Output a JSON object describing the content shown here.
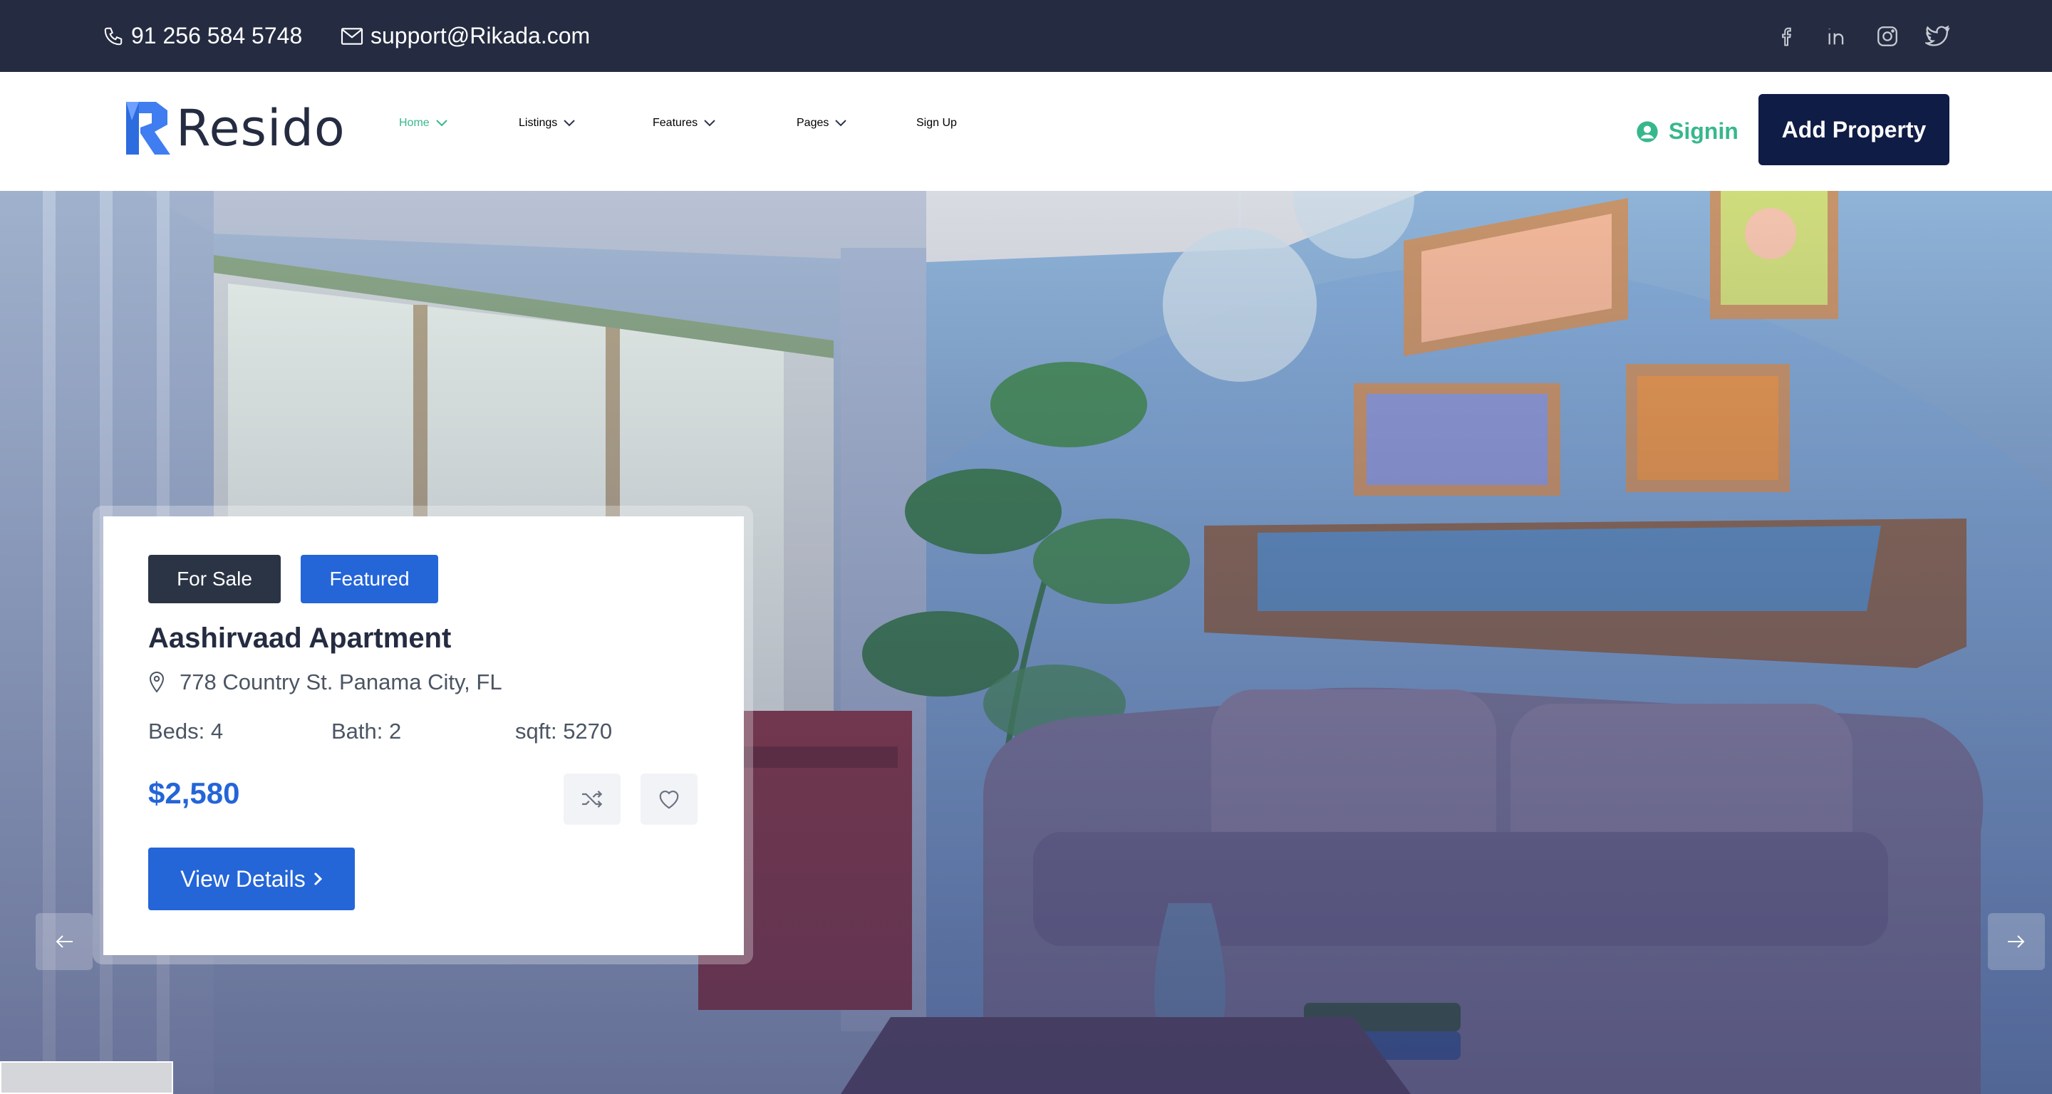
{
  "topbar": {
    "phone": "91 256 584 5748",
    "email": "support@Rikada.com",
    "phone_icon": "phone-icon",
    "email_icon": "envelope-icon",
    "social": [
      "facebook-icon",
      "linkedin-icon",
      "instagram-icon",
      "twitter-icon"
    ]
  },
  "brand": {
    "name": "Resido"
  },
  "nav": {
    "items": [
      {
        "label": "Home",
        "dropdown": true,
        "active": true
      },
      {
        "label": "Listings",
        "dropdown": true
      },
      {
        "label": "Features",
        "dropdown": true
      },
      {
        "label": "Pages",
        "dropdown": true
      },
      {
        "label": "Sign Up",
        "dropdown": false
      }
    ],
    "signin_label": "Signin",
    "add_property_label": "Add Property"
  },
  "property": {
    "badges": [
      "For Sale",
      "Featured"
    ],
    "title": "Aashirvaad Apartment",
    "address": "778 Country St. Panama City, FL",
    "beds": "Beds: 4",
    "bath": "Bath: 2",
    "sqft": "sqft: 5270",
    "price": "$2,580",
    "view_details_label": "View Details"
  },
  "colors": {
    "topbar_bg": "#252c41",
    "accent_green": "#37b88b",
    "primary_blue": "#2465d8",
    "navy": "#0f1c45"
  }
}
